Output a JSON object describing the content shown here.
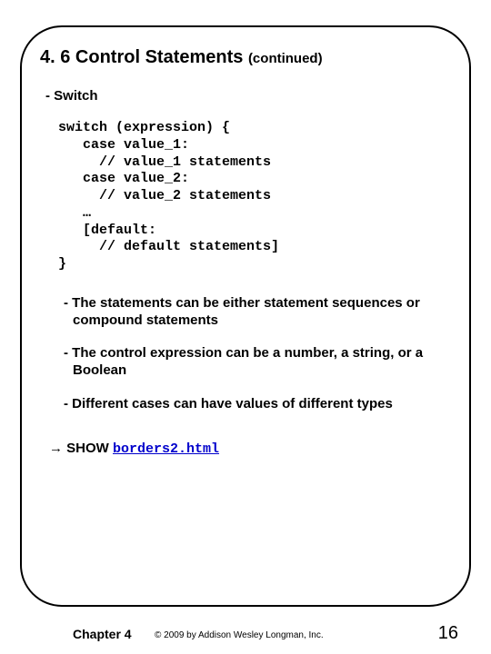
{
  "title": {
    "main": "4. 6 Control Statements ",
    "continued": "(continued)"
  },
  "subhead": "- Switch",
  "code": "switch (expression) {\n   case value_1:\n     // value_1 statements\n   case value_2:\n     // value_2 statements\n   …\n   [default:\n     // default statements]\n}",
  "bullets": {
    "b1": "- The statements can be either statement sequences or compound statements",
    "b2": "- The control expression can be a number, a string, or a Boolean",
    "b3": "- Different cases can have values of different types"
  },
  "show": {
    "arrow": "→",
    "label": " SHOW ",
    "link_text": "borders2.html"
  },
  "footer": {
    "chapter": "Chapter 4",
    "copyright": "© 2009 by Addison Wesley Longman, Inc.",
    "page": "16"
  }
}
